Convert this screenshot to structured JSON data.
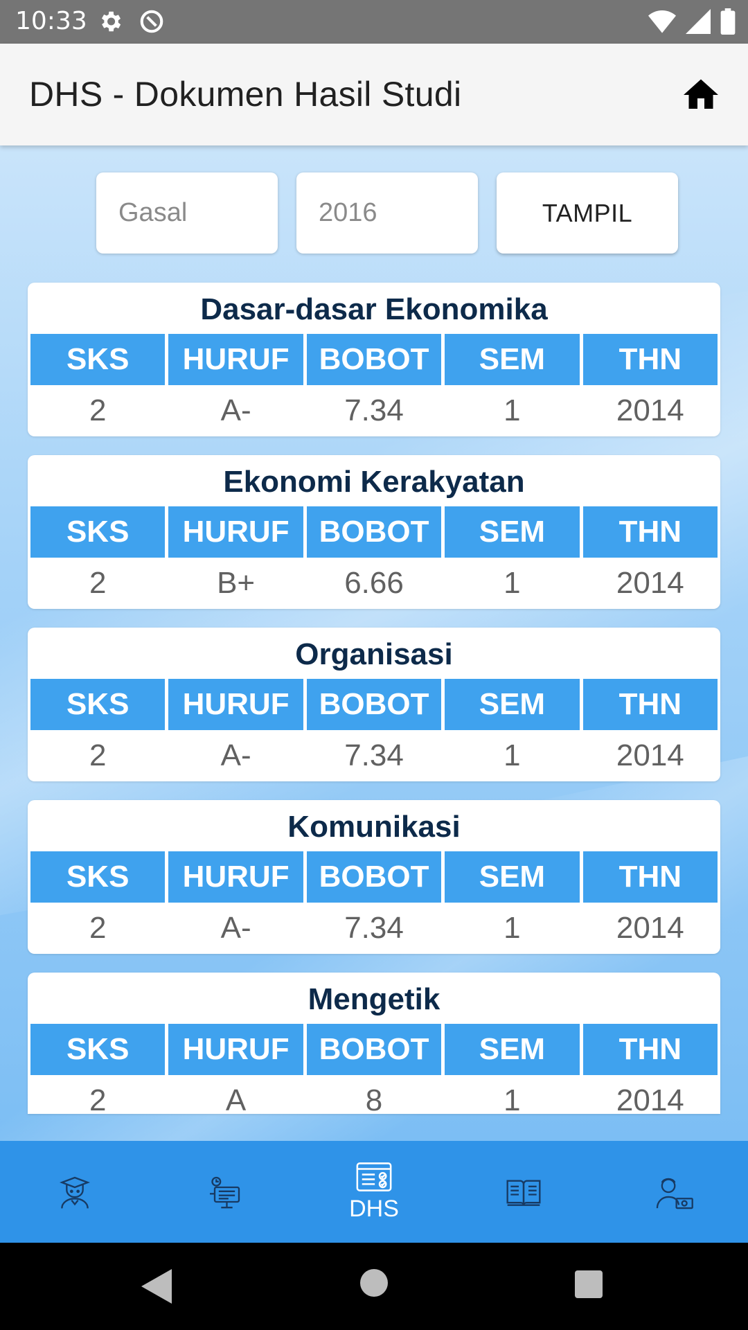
{
  "status_bar": {
    "time": "10:33",
    "icons": [
      "gear-icon",
      "do-not-disturb-icon",
      "wifi-icon",
      "signal-icon",
      "battery-icon"
    ]
  },
  "app_bar": {
    "title": "DHS - Dokumen Hasil Studi",
    "home_icon": "home-icon"
  },
  "filter": {
    "semester_placeholder": "Gasal",
    "year_placeholder": "2016",
    "show_button": "TAMPIL"
  },
  "columns": [
    "SKS",
    "HURUF",
    "BOBOT",
    "SEM",
    "THN"
  ],
  "courses": [
    {
      "name": "Dasar-dasar Ekonomika",
      "sks": "2",
      "huruf": "A-",
      "bobot": "7.34",
      "sem": "1",
      "thn": "2014"
    },
    {
      "name": "Ekonomi Kerakyatan",
      "sks": "2",
      "huruf": "B+",
      "bobot": "6.66",
      "sem": "1",
      "thn": "2014"
    },
    {
      "name": "Organisasi",
      "sks": "2",
      "huruf": "A-",
      "bobot": "7.34",
      "sem": "1",
      "thn": "2014"
    },
    {
      "name": "Komunikasi",
      "sks": "2",
      "huruf": "A-",
      "bobot": "7.34",
      "sem": "1",
      "thn": "2014"
    },
    {
      "name": "Mengetik",
      "sks": "2",
      "huruf": "A",
      "bobot": "8",
      "sem": "1",
      "thn": "2014"
    }
  ],
  "bottom_nav": {
    "items": [
      {
        "icon": "student-icon",
        "label": ""
      },
      {
        "icon": "presentation-icon",
        "label": ""
      },
      {
        "icon": "dhs-icon",
        "label": "DHS"
      },
      {
        "icon": "book-icon",
        "label": ""
      },
      {
        "icon": "payment-icon",
        "label": ""
      }
    ],
    "active": "DHS"
  },
  "colors": {
    "status_bar": "#757575",
    "app_bar": "#f5f5f5",
    "header_cell": "#3fa2ee",
    "bottom_nav": "#2f93e8",
    "course_title": "#0d2a4a"
  }
}
